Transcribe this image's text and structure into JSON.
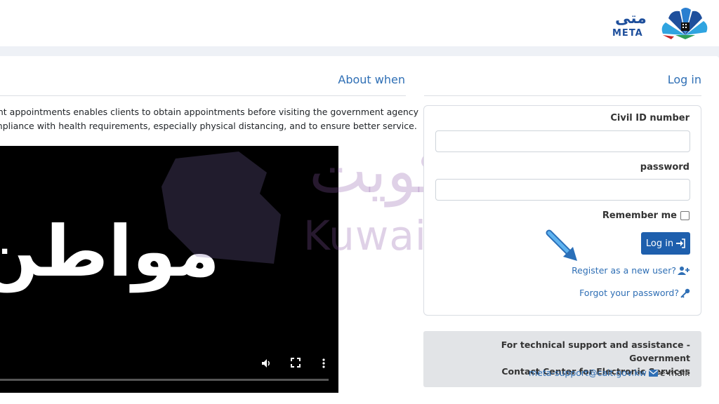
{
  "header": {
    "logo_ar": "متى",
    "logo_en": "META"
  },
  "about": {
    "title": "About when",
    "text_line1": "ment appointments enables clients to obtain appointments before visiting the government agency",
    "text_line2": "compliance with health requirements, especially physical distancing, and to ensure better service."
  },
  "video": {
    "overlay_text": "مواطن"
  },
  "login": {
    "title": "Log in",
    "civil_id_label": "Civil ID number",
    "civil_id_value": "",
    "password_label": "password",
    "password_value": "",
    "remember_label": "Remember me",
    "remember_checked": false,
    "button_label": "Log in",
    "register_link": "Register as a new user?",
    "forgot_link": "Forgot your password?"
  },
  "support": {
    "line1": "For technical support and assistance - Government",
    "line2": "Contact Center for Electronic Services",
    "email": "meta-support@cait.gov.kw",
    "email_label": "e-mail:"
  },
  "watermark": {
    "arabic": "الكويت",
    "english": "Kuwaits Expat"
  },
  "colors": {
    "brand_blue": "#1e5fad",
    "link_blue": "#2f6fb5",
    "page_bg": "#eef1f6",
    "support_bg": "#e2e4e7"
  }
}
